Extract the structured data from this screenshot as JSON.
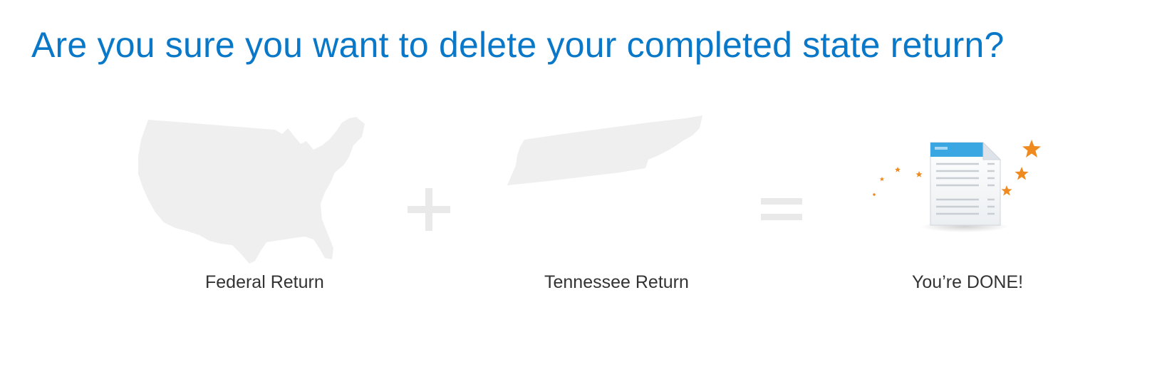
{
  "title": "Are you sure you want to delete your completed state return?",
  "steps": {
    "federal_label": "Federal Return",
    "state_label": "Tennessee Return",
    "done_label": "You’re DONE!"
  },
  "icons": {
    "plus": "plus-icon",
    "equals": "equals-icon",
    "federal": "us-map-icon",
    "state": "tennessee-map-icon",
    "done": "completed-return-document-icon"
  },
  "colors": {
    "title": "#0a78c8",
    "caption": "#333333",
    "map_fill": "#efefef",
    "operator": "#e9e9e9",
    "doc_header": "#3aa7e3",
    "star": "#ef8a1f"
  }
}
